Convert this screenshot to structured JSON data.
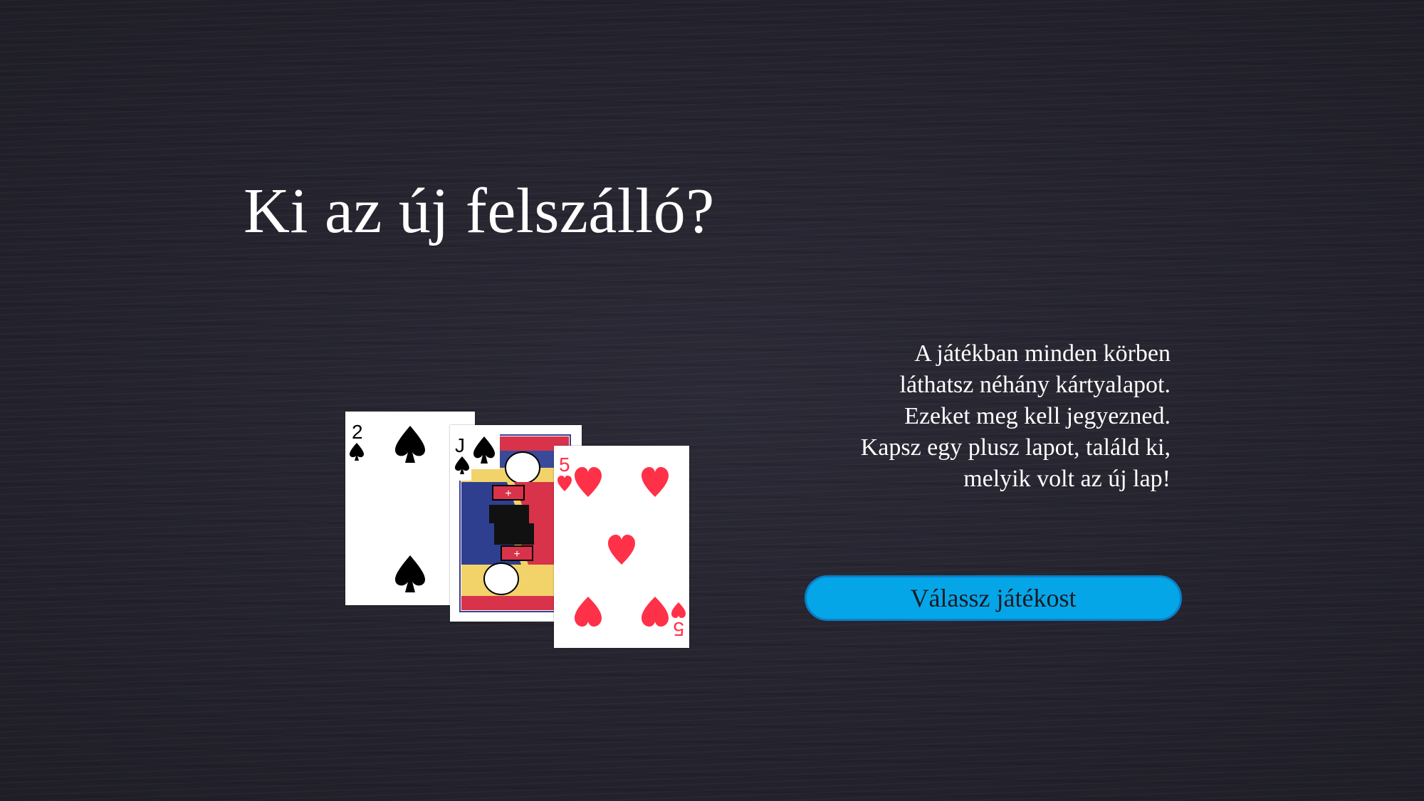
{
  "title": "Ki az új felszálló?",
  "intro": {
    "lines": [
      "A játékban minden körben",
      "láthatsz néhány kártyalapot.",
      "Ezeket meg kell jegyezned.",
      "Kapsz egy plusz lapot, találd ki,",
      "melyik volt az új lap!"
    ]
  },
  "start_button": {
    "label": "Válassz játékost",
    "color": "#04a6e8"
  },
  "cards": [
    {
      "rank": "2",
      "suit": "spades",
      "color": "#000000"
    },
    {
      "rank": "J",
      "suit": "spades",
      "color": "#000000"
    },
    {
      "rank": "5",
      "suit": "hearts",
      "color": "#ff3148"
    }
  ],
  "colors": {
    "background": "#25242f",
    "text": "#ffffff",
    "heart_red": "#ff3148"
  }
}
